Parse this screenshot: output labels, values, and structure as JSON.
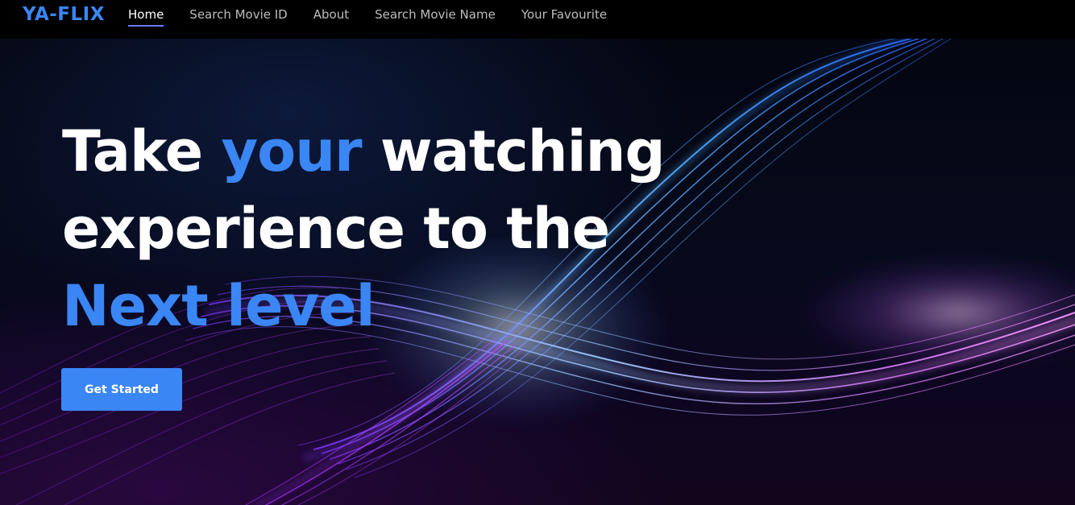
{
  "brand": "YA-FLIX",
  "nav": {
    "items": [
      {
        "label": "Home",
        "active": true
      },
      {
        "label": "Search Movie ID",
        "active": false
      },
      {
        "label": "About",
        "active": false
      },
      {
        "label": "Search Movie Name",
        "active": false
      },
      {
        "label": "Your Favourite",
        "active": false
      }
    ]
  },
  "hero": {
    "line1": {
      "part1": "Take ",
      "accent": "your",
      "part2": " watching"
    },
    "line2": "experience to the",
    "line3": "Next level",
    "cta_label": "Get Started"
  },
  "colors": {
    "accent": "#3a86f5",
    "nav_background": "#000000",
    "active_underline": "#6b7cff"
  }
}
